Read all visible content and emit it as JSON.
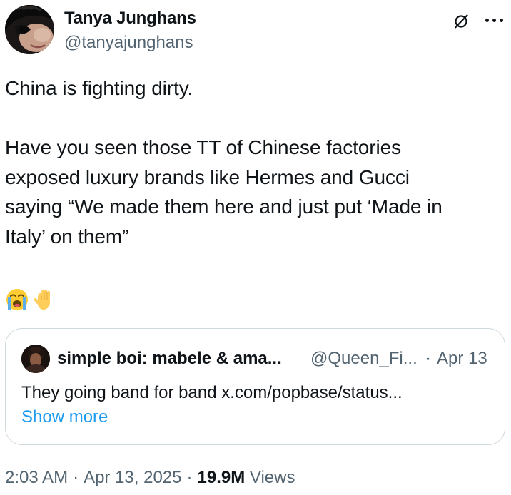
{
  "tweet": {
    "author": {
      "name": "Tanya Junghans",
      "handle": "@tanyajunghans"
    },
    "icons": {
      "grok": "grok-slash-circle-icon",
      "more": "more-dots-icon"
    },
    "text": "China is fighting dirty.\n\nHave you seen those TT of Chinese factories\nexposed luxury brands like Hermes and Gucci\nsaying “We made them here and just put ‘Made in\nItaly’ on them”",
    "emojis": [
      "loudly-crying-face",
      "raised-hand"
    ],
    "quoted": {
      "name": "simple boi: mabele & ama...",
      "handle": "@Queen_Fi...",
      "separator": "·",
      "date": "Apr 13",
      "text": "They going band for band x.com/popbase/status...",
      "show_more": "Show more"
    },
    "meta": {
      "time": "2:03 AM",
      "dot1": "·",
      "date": "Apr 13, 2025",
      "dot2": "·",
      "views_count": "19.9M",
      "views_label": "Views"
    }
  },
  "colors": {
    "text": "#0f1419",
    "secondary": "#536471",
    "link": "#1d9bf0",
    "border": "#cfd9de"
  }
}
